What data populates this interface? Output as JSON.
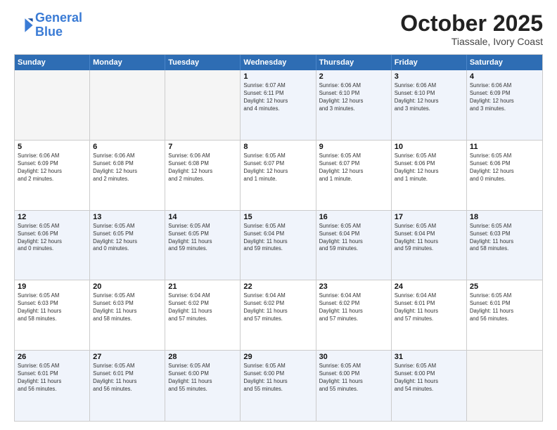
{
  "header": {
    "logo_line1": "General",
    "logo_line2": "Blue",
    "month_title": "October 2025",
    "location": "Tiassale, Ivory Coast"
  },
  "weekdays": [
    "Sunday",
    "Monday",
    "Tuesday",
    "Wednesday",
    "Thursday",
    "Friday",
    "Saturday"
  ],
  "rows": [
    [
      {
        "day": "",
        "info": "",
        "empty": true
      },
      {
        "day": "",
        "info": "",
        "empty": true
      },
      {
        "day": "",
        "info": "",
        "empty": true
      },
      {
        "day": "1",
        "info": "Sunrise: 6:07 AM\nSunset: 6:11 PM\nDaylight: 12 hours\nand 4 minutes."
      },
      {
        "day": "2",
        "info": "Sunrise: 6:06 AM\nSunset: 6:10 PM\nDaylight: 12 hours\nand 3 minutes."
      },
      {
        "day": "3",
        "info": "Sunrise: 6:06 AM\nSunset: 6:10 PM\nDaylight: 12 hours\nand 3 minutes."
      },
      {
        "day": "4",
        "info": "Sunrise: 6:06 AM\nSunset: 6:09 PM\nDaylight: 12 hours\nand 3 minutes."
      }
    ],
    [
      {
        "day": "5",
        "info": "Sunrise: 6:06 AM\nSunset: 6:09 PM\nDaylight: 12 hours\nand 2 minutes."
      },
      {
        "day": "6",
        "info": "Sunrise: 6:06 AM\nSunset: 6:08 PM\nDaylight: 12 hours\nand 2 minutes."
      },
      {
        "day": "7",
        "info": "Sunrise: 6:06 AM\nSunset: 6:08 PM\nDaylight: 12 hours\nand 2 minutes."
      },
      {
        "day": "8",
        "info": "Sunrise: 6:05 AM\nSunset: 6:07 PM\nDaylight: 12 hours\nand 1 minute."
      },
      {
        "day": "9",
        "info": "Sunrise: 6:05 AM\nSunset: 6:07 PM\nDaylight: 12 hours\nand 1 minute."
      },
      {
        "day": "10",
        "info": "Sunrise: 6:05 AM\nSunset: 6:06 PM\nDaylight: 12 hours\nand 1 minute."
      },
      {
        "day": "11",
        "info": "Sunrise: 6:05 AM\nSunset: 6:06 PM\nDaylight: 12 hours\nand 0 minutes."
      }
    ],
    [
      {
        "day": "12",
        "info": "Sunrise: 6:05 AM\nSunset: 6:06 PM\nDaylight: 12 hours\nand 0 minutes."
      },
      {
        "day": "13",
        "info": "Sunrise: 6:05 AM\nSunset: 6:05 PM\nDaylight: 12 hours\nand 0 minutes."
      },
      {
        "day": "14",
        "info": "Sunrise: 6:05 AM\nSunset: 6:05 PM\nDaylight: 11 hours\nand 59 minutes."
      },
      {
        "day": "15",
        "info": "Sunrise: 6:05 AM\nSunset: 6:04 PM\nDaylight: 11 hours\nand 59 minutes."
      },
      {
        "day": "16",
        "info": "Sunrise: 6:05 AM\nSunset: 6:04 PM\nDaylight: 11 hours\nand 59 minutes."
      },
      {
        "day": "17",
        "info": "Sunrise: 6:05 AM\nSunset: 6:04 PM\nDaylight: 11 hours\nand 59 minutes."
      },
      {
        "day": "18",
        "info": "Sunrise: 6:05 AM\nSunset: 6:03 PM\nDaylight: 11 hours\nand 58 minutes."
      }
    ],
    [
      {
        "day": "19",
        "info": "Sunrise: 6:05 AM\nSunset: 6:03 PM\nDaylight: 11 hours\nand 58 minutes."
      },
      {
        "day": "20",
        "info": "Sunrise: 6:05 AM\nSunset: 6:03 PM\nDaylight: 11 hours\nand 58 minutes."
      },
      {
        "day": "21",
        "info": "Sunrise: 6:04 AM\nSunset: 6:02 PM\nDaylight: 11 hours\nand 57 minutes."
      },
      {
        "day": "22",
        "info": "Sunrise: 6:04 AM\nSunset: 6:02 PM\nDaylight: 11 hours\nand 57 minutes."
      },
      {
        "day": "23",
        "info": "Sunrise: 6:04 AM\nSunset: 6:02 PM\nDaylight: 11 hours\nand 57 minutes."
      },
      {
        "day": "24",
        "info": "Sunrise: 6:04 AM\nSunset: 6:01 PM\nDaylight: 11 hours\nand 57 minutes."
      },
      {
        "day": "25",
        "info": "Sunrise: 6:05 AM\nSunset: 6:01 PM\nDaylight: 11 hours\nand 56 minutes."
      }
    ],
    [
      {
        "day": "26",
        "info": "Sunrise: 6:05 AM\nSunset: 6:01 PM\nDaylight: 11 hours\nand 56 minutes."
      },
      {
        "day": "27",
        "info": "Sunrise: 6:05 AM\nSunset: 6:01 PM\nDaylight: 11 hours\nand 56 minutes."
      },
      {
        "day": "28",
        "info": "Sunrise: 6:05 AM\nSunset: 6:00 PM\nDaylight: 11 hours\nand 55 minutes."
      },
      {
        "day": "29",
        "info": "Sunrise: 6:05 AM\nSunset: 6:00 PM\nDaylight: 11 hours\nand 55 minutes."
      },
      {
        "day": "30",
        "info": "Sunrise: 6:05 AM\nSunset: 6:00 PM\nDaylight: 11 hours\nand 55 minutes."
      },
      {
        "day": "31",
        "info": "Sunrise: 6:05 AM\nSunset: 6:00 PM\nDaylight: 11 hours\nand 54 minutes."
      },
      {
        "day": "",
        "info": "",
        "empty": true
      }
    ]
  ]
}
